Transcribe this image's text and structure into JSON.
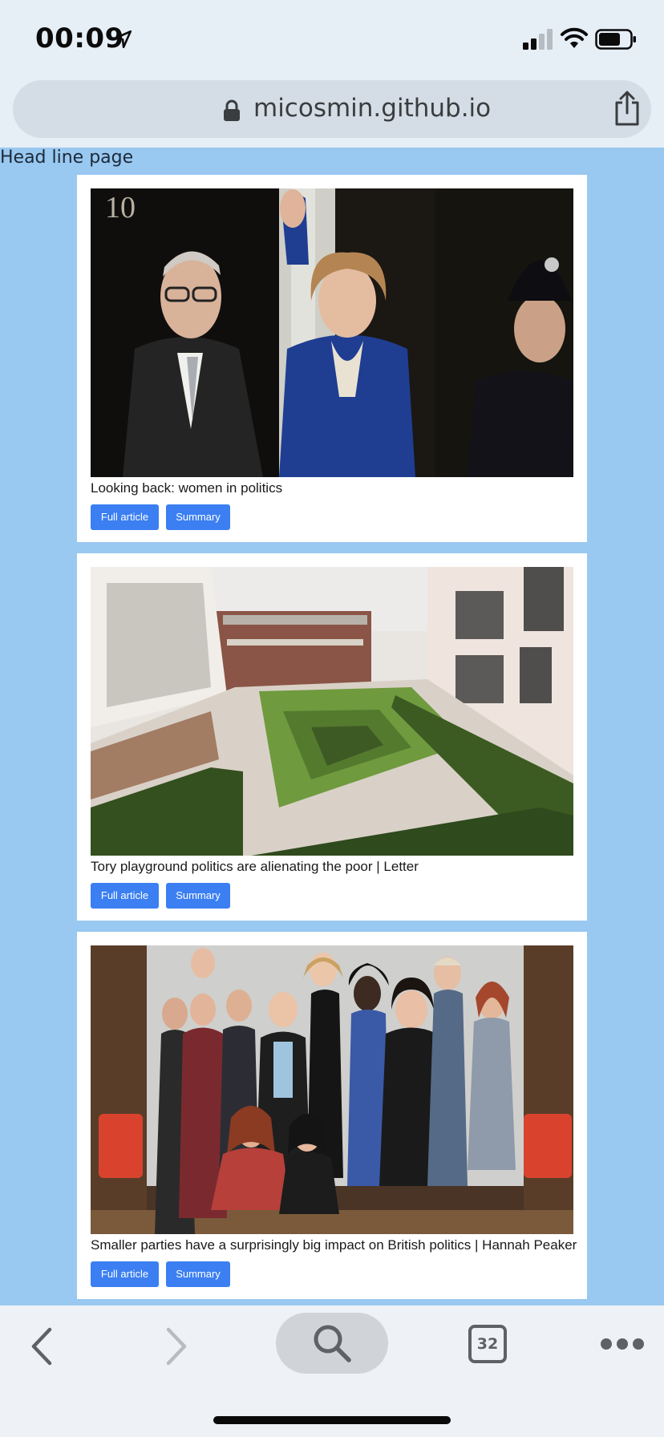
{
  "status_bar": {
    "time": "00:09",
    "icons": [
      "location-arrow-icon",
      "cellular-signal-icon",
      "wifi-icon",
      "battery-icon"
    ]
  },
  "browser": {
    "url": "micosmin.github.io",
    "tab_count": "32",
    "icons": [
      "lock-icon",
      "share-icon",
      "back-icon",
      "forward-icon",
      "search-icon",
      "tabs-icon",
      "more-icon"
    ]
  },
  "page": {
    "heading": "Head line page",
    "articles": [
      {
        "title": "Looking back: women in politics",
        "full_label": "Full article",
        "summary_label": "Summary"
      },
      {
        "title": "Tory playground politics are alienating the poor | Letter",
        "full_label": "Full article",
        "summary_label": "Summary"
      },
      {
        "title": "Smaller parties have a surprisingly big impact on British politics | Hannah Peaker",
        "full_label": "Full article",
        "summary_label": "Summary"
      }
    ]
  },
  "colors": {
    "page_bg": "#99c8f0",
    "button_bg": "#3b7ff2",
    "chrome_bg": "#e6eef6"
  }
}
